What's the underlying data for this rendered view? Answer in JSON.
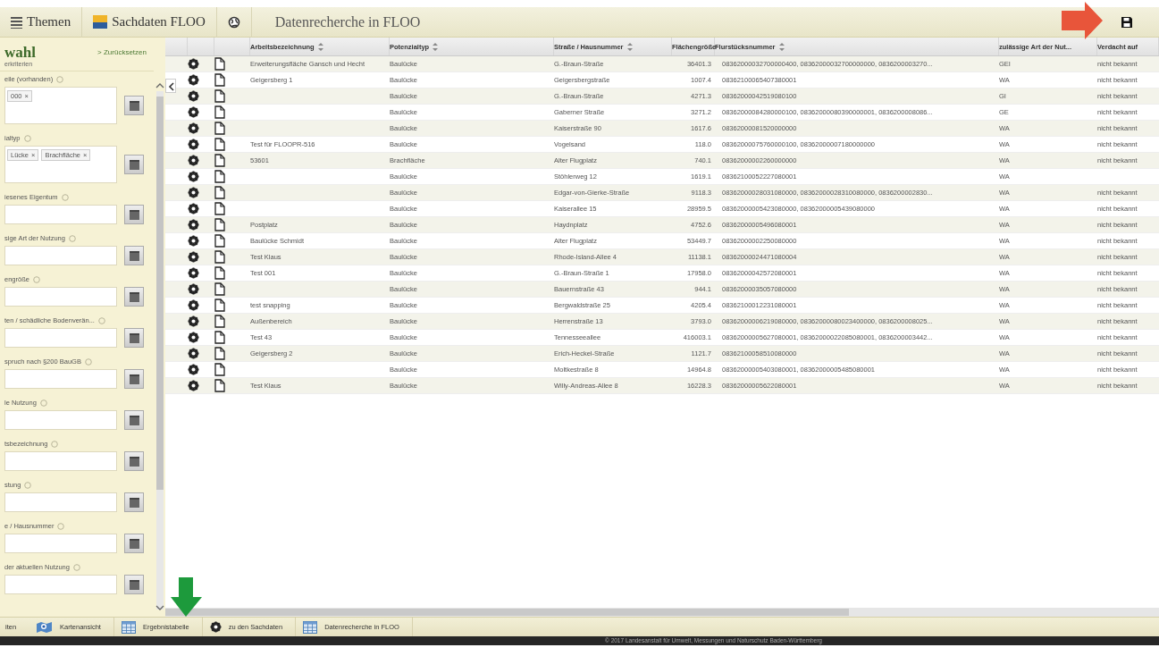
{
  "toolbar": {
    "items": [
      {
        "kind": "menu",
        "label": "Themen"
      },
      {
        "kind": "data",
        "label": "Sachdaten FLOO"
      },
      {
        "kind": "globe"
      }
    ],
    "title": "Datenrecherche in FLOO"
  },
  "annotations": [
    {
      "kind": "arrow-right"
    },
    {
      "kind": "arrow-down"
    }
  ],
  "filter_panel": {
    "title": "wahl",
    "subtitle": "erkriterien",
    "reset_link": "> Zurücksetzen",
    "fields": [
      {
        "label": "eile (vorhanden)",
        "tags": [
          {
            "label": "000",
            "remove": "×"
          }
        ]
      },
      {
        "label": "ialtyp",
        "tags": [
          {
            "label": "Lücke",
            "remove": "×"
          },
          {
            "label": "Brachfläche",
            "remove": "×"
          }
        ]
      },
      {
        "label": "iesenes Eigentum"
      },
      {
        "label": "sige Art der Nutzung"
      },
      {
        "label": "engröße"
      },
      {
        "label": "ten / schädliche Bodenverän..."
      },
      {
        "label": "spruch nach §200 BauGB"
      },
      {
        "label": "le Nutzung"
      },
      {
        "label": "tsbezeichnung"
      },
      {
        "label": "stung"
      },
      {
        "label": "e / Hausnummer"
      },
      {
        "label": "der aktuellen Nutzung"
      }
    ]
  },
  "table": {
    "columns": [
      "Arbeitsbezeichnung",
      "Potenzialtyp",
      "Straße / Hausnummer",
      "Flächengröße",
      "Flurstücksnummer",
      "zulässige Art der Nut...",
      "Verdacht auf"
    ],
    "rows": [
      {
        "designation": "Erweiterungsfläche Gansch und Hecht",
        "potential_type": "Baulücke",
        "street": "G.-Braun-Straße",
        "area": "36401.3",
        "parcel": "08362000032700000400, 08362000032700000000, 0836200003270...",
        "permitted_use": "GEI",
        "suspicion": "nicht bekannt"
      },
      {
        "designation": "Geigersberg 1",
        "potential_type": "Baulücke",
        "street": "Geigersbergstraße",
        "area": "1007.4",
        "parcel": "08362100065407380001",
        "permitted_use": "WA",
        "suspicion": "nicht bekannt"
      },
      {
        "potential_type": "Baulücke",
        "street": "G.-Braun-Straße",
        "area": "4271.3",
        "parcel": "08362000042519080100",
        "permitted_use": "GI",
        "suspicion": "nicht bekannt"
      },
      {
        "potential_type": "Baulücke",
        "street": "Gaberner Straße",
        "area": "3271.2",
        "parcel": "08362000084280000100, 08362000080390000001, 0836200008086...",
        "permitted_use": "GE",
        "suspicion": "nicht bekannt"
      },
      {
        "potential_type": "Baulücke",
        "street": "Kaiserstraße 90",
        "area": "1617.6",
        "parcel": "08362000081520000000",
        "permitted_use": "WA",
        "suspicion": "nicht bekannt"
      },
      {
        "designation": "Test für FLOOPR-516",
        "potential_type": "Baulücke",
        "street": "Vogelsand",
        "area": "118.0",
        "parcel": "08362000075760000100, 08362000007180000000",
        "permitted_use": "WA",
        "suspicion": "nicht bekannt"
      },
      {
        "designation": "53601",
        "potential_type": "Brachfläche",
        "street": "Alter Flugplatz",
        "area": "740.1",
        "parcel": "08362000002260000000",
        "permitted_use": "WA",
        "suspicion": "nicht bekannt"
      },
      {
        "potential_type": "Baulücke",
        "street": "Stöhlerweg 12",
        "area": "1619.1",
        "parcel": "08362100052227080001",
        "permitted_use": "WA"
      },
      {
        "potential_type": "Baulücke",
        "street": "Edgar-von-Gierke-Straße",
        "area": "9118.3",
        "parcel": "08362000028031080000, 08362000028310080000, 0836200002830...",
        "permitted_use": "WA",
        "suspicion": "nicht bekannt"
      },
      {
        "potential_type": "Baulücke",
        "street": "Kaiserallee 15",
        "area": "28959.5",
        "parcel": "08362000005423080000, 08362000005439080000",
        "permitted_use": "WA",
        "suspicion": "nicht bekannt"
      },
      {
        "designation": "Postplatz",
        "potential_type": "Baulücke",
        "street": "Haydnplatz",
        "area": "4752.6",
        "parcel": "08362000005496080001",
        "permitted_use": "WA",
        "suspicion": "nicht bekannt"
      },
      {
        "designation": "Baulücke Schmidt",
        "potential_type": "Baulücke",
        "street": "Alter Flugplatz",
        "area": "53449.7",
        "parcel": "08362000002250080000",
        "permitted_use": "WA",
        "suspicion": "nicht bekannt"
      },
      {
        "designation": "Test Klaus",
        "potential_type": "Baulücke",
        "street": "Rhode-Island-Allee 4",
        "area": "11138.1",
        "parcel": "08362000024471080004",
        "permitted_use": "WA",
        "suspicion": "nicht bekannt"
      },
      {
        "designation": "Test 001",
        "potential_type": "Baulücke",
        "street": "G.-Braun-Straße 1",
        "area": "17958.0",
        "parcel": "08362000042572080001",
        "permitted_use": "WA",
        "suspicion": "nicht bekannt"
      },
      {
        "potential_type": "Baulücke",
        "street": "Bauernstraße 43",
        "area": "944.1",
        "parcel": "08362000035057080000",
        "permitted_use": "WA",
        "suspicion": "nicht bekannt"
      },
      {
        "designation": "test snapping",
        "potential_type": "Baulücke",
        "street": "Bergwaldstraße 25",
        "area": "4205.4",
        "parcel": "08362100012231080001",
        "permitted_use": "WA",
        "suspicion": "nicht bekannt"
      },
      {
        "designation": "Außenbereich",
        "potential_type": "Baulücke",
        "street": "Herrenstraße 13",
        "area": "3793.0",
        "parcel": "08362000006219080000, 08362000080023400000, 0836200008025...",
        "permitted_use": "WA",
        "suspicion": "nicht bekannt"
      },
      {
        "designation": "Test 43",
        "potential_type": "Baulücke",
        "street": "Tennesseeallee",
        "area": "416003.1",
        "parcel": "08362000005627080001, 08362000022085080001, 0836200003442...",
        "permitted_use": "WA",
        "suspicion": "nicht bekannt"
      },
      {
        "designation": "Geigersberg 2",
        "potential_type": "Baulücke",
        "street": "Erich-Heckel-Straße",
        "area": "1121.7",
        "parcel": "08362100058510080000",
        "permitted_use": "WA",
        "suspicion": "nicht bekannt"
      },
      {
        "potential_type": "Baulücke",
        "street": "Moltkestraße 8",
        "area": "14964.8",
        "parcel": "08362000005403080001, 08362000005485080001",
        "permitted_use": "WA",
        "suspicion": "nicht bekannt"
      },
      {
        "designation": "Test Klaus",
        "potential_type": "Baulücke",
        "street": "Willy-Andreas-Allee 8",
        "area": "16228.3",
        "parcel": "08362000005622080001",
        "permitted_use": "WA",
        "suspicion": "nicht bekannt"
      }
    ]
  },
  "bottom_bar": {
    "label": "iten",
    "tabs": [
      {
        "kind": "map",
        "label": "Kartenansicht"
      },
      {
        "kind": "table",
        "label": "Ergebnistabelle"
      },
      {
        "kind": "gear",
        "label": "zu den Sachdaten"
      },
      {
        "kind": "table",
        "label": "Datenrecherche in FLOO"
      }
    ]
  },
  "footer": "© 2017 Landesanstalt für Umwelt, Messungen und Naturschutz Baden-Württemberg"
}
